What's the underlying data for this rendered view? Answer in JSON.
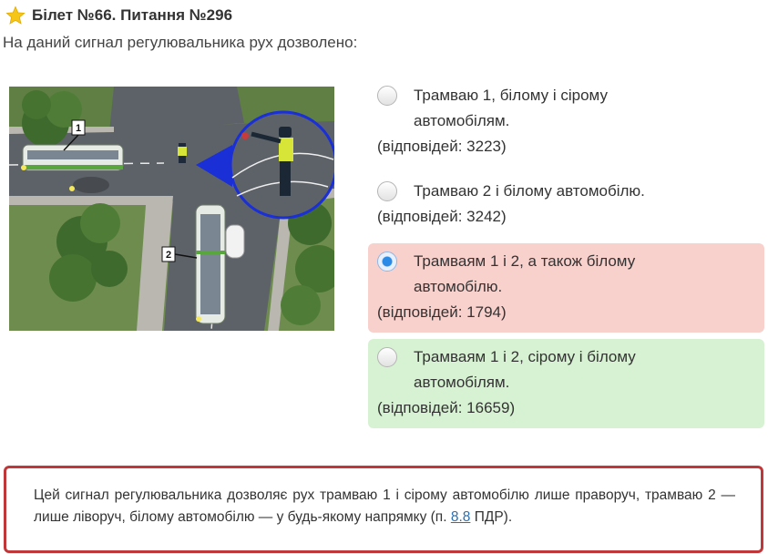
{
  "header": {
    "title": "Білет №66. Питання №296",
    "question": "На даний сигнал регулювальника рух дозволено:"
  },
  "image": {
    "label_1": "1",
    "label_2": "2"
  },
  "answers": [
    {
      "line1": "Трамваю 1, білому і сірому",
      "line2": "автомобілям.",
      "count": "(відповідей: 3223)",
      "state": "none"
    },
    {
      "line1": "Трамваю 2 і білому автомобілю.",
      "line2": "",
      "count": "(відповідей: 3242)",
      "state": "none"
    },
    {
      "line1": "Трамваям 1 і 2, а також білому",
      "line2": "автомобілю.",
      "count": "(відповідей: 1794)",
      "state": "wrong"
    },
    {
      "line1": "Трамваям 1 і 2, сірому і білому",
      "line2": "автомобілям.",
      "count": "(відповідей: 16659)",
      "state": "correct"
    }
  ],
  "explanation": {
    "text": "Цей сигнал регулювальника дозволяє рух трамваю 1 і сірому автомобілю лише праворуч, трамваю 2 — лише ліворуч, білому автомобілю — у будь-якому напрямку (п. ",
    "link": "8.8",
    "suffix": " ПДР)."
  },
  "colors": {
    "wrong_bg": "#f8d0cc",
    "correct_bg": "#d7f2d2",
    "explain_border": "#c0373a",
    "link": "#2a6fb3",
    "star": "#f5c518"
  },
  "icons": {
    "header": "star-icon"
  }
}
